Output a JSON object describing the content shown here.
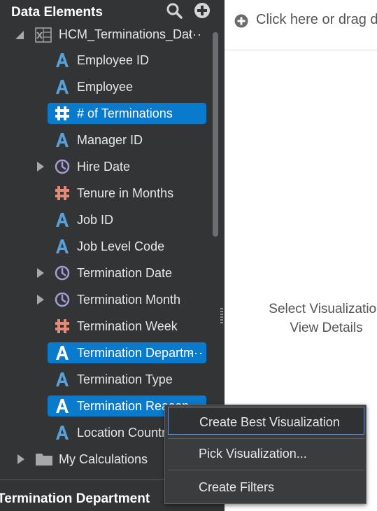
{
  "panel": {
    "title": "Data Elements",
    "root": {
      "label": "HCM_Terminations_Dat",
      "more": "···",
      "icon": "excel-datasource-icon"
    },
    "items": [
      {
        "label": "Employee ID",
        "type": "attribute",
        "selected": false
      },
      {
        "label": "Employee",
        "type": "attribute",
        "selected": false
      },
      {
        "label": "# of Terminations",
        "type": "measure",
        "selected": true
      },
      {
        "label": "Manager ID",
        "type": "attribute",
        "selected": false
      },
      {
        "label": "Hire Date",
        "type": "time",
        "selected": false
      },
      {
        "label": "Tenure in Months",
        "type": "measure",
        "selected": false
      },
      {
        "label": "Job ID",
        "type": "attribute",
        "selected": false
      },
      {
        "label": "Job Level Code",
        "type": "attribute",
        "selected": false
      },
      {
        "label": "Termination Date",
        "type": "time",
        "selected": false
      },
      {
        "label": "Termination Month",
        "type": "time",
        "selected": false
      },
      {
        "label": "Termination Week",
        "type": "measure",
        "selected": false
      },
      {
        "label": "Termination Departm",
        "more": "···",
        "type": "attribute",
        "selected": true
      },
      {
        "label": "Termination Type",
        "type": "attribute",
        "selected": false
      },
      {
        "label": "Termination Reason",
        "type": "attribute",
        "selected": true
      },
      {
        "label": "Location Country",
        "type": "attribute",
        "selected": false
      }
    ],
    "calculations_label": "My Calculations",
    "bottom_title": "Termination Department"
  },
  "canvas": {
    "drop_hint": "Click here or drag d",
    "empty_line1": "Select Visualization",
    "empty_line2": "View Details"
  },
  "context_menu": {
    "items": [
      {
        "label": "Create Best Visualization",
        "active": true
      },
      {
        "label": "Pick Visualization...",
        "active": false
      },
      {
        "label": "Create Filters",
        "active": false
      }
    ]
  },
  "colors": {
    "panel_bg": "#323436",
    "selected_bg": "#0a7acc",
    "attribute_icon": "#5aa0d8",
    "measure_icon": "#e58a78",
    "time_icon": "#a79ad6"
  }
}
